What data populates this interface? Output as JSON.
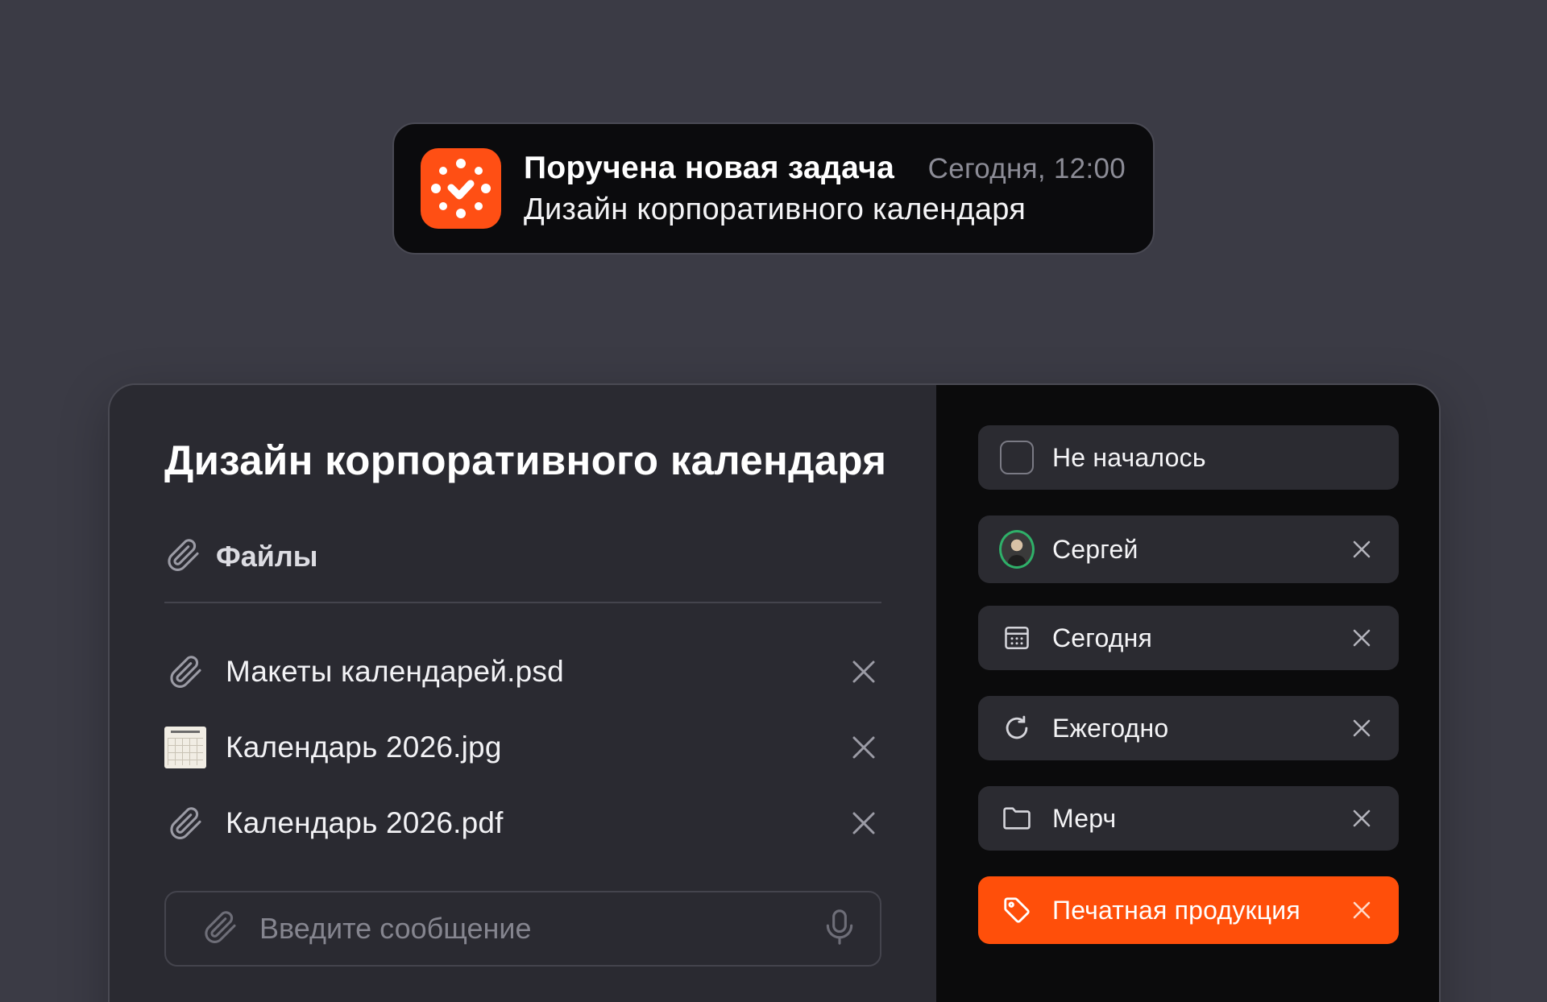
{
  "notification": {
    "title": "Поручена новая задача",
    "time": "Сегодня, 12:00",
    "subtitle": "Дизайн корпоративного календаря",
    "app_icon": "app-logo-icon",
    "accent_color": "#ff4f14"
  },
  "task": {
    "title": "Дизайн корпоративного календаря",
    "files_label": "Файлы",
    "files": [
      {
        "name": "Макеты календарей.psd",
        "icon": "paperclip-icon"
      },
      {
        "name": "Календарь 2026.jpg",
        "icon": "image-thumbnail"
      },
      {
        "name": "Календарь 2026.pdf",
        "icon": "paperclip-icon"
      }
    ],
    "message_placeholder": "Введите сообщение"
  },
  "properties": {
    "status": "Не началось",
    "assignee": "Сергей",
    "due": "Сегодня",
    "repeat": "Ежегодно",
    "project": "Мерч",
    "tag": "Печатная продукция",
    "tag_color": "#ff4f0a"
  }
}
